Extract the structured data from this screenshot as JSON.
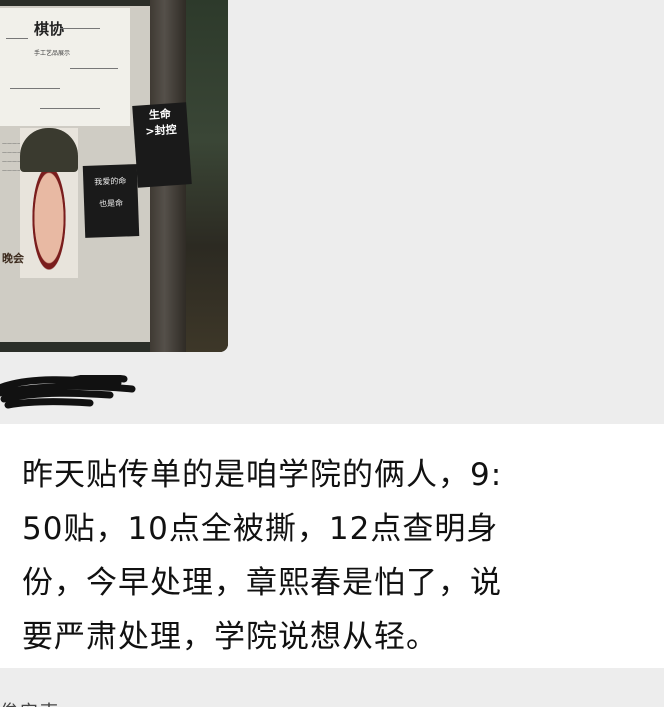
{
  "image_message": {
    "poster_title": "棋协",
    "poster_subtitle": "手工艺品展示",
    "poster_bottom_text": "晚会",
    "sticker_left": [
      "我爱的命",
      "也是命"
    ],
    "sticker_right": [
      "生命",
      ">封控"
    ]
  },
  "text_message": {
    "lines": [
      "昨天贴传单的是咱学院的俩人，9:",
      "50贴，10点全被撕，12点查明身",
      "份，今早处理，章熙春是怕了，说",
      "要严肃处理，学院说想从轻。"
    ]
  },
  "bottom_sender_fragment": "俊安南"
}
